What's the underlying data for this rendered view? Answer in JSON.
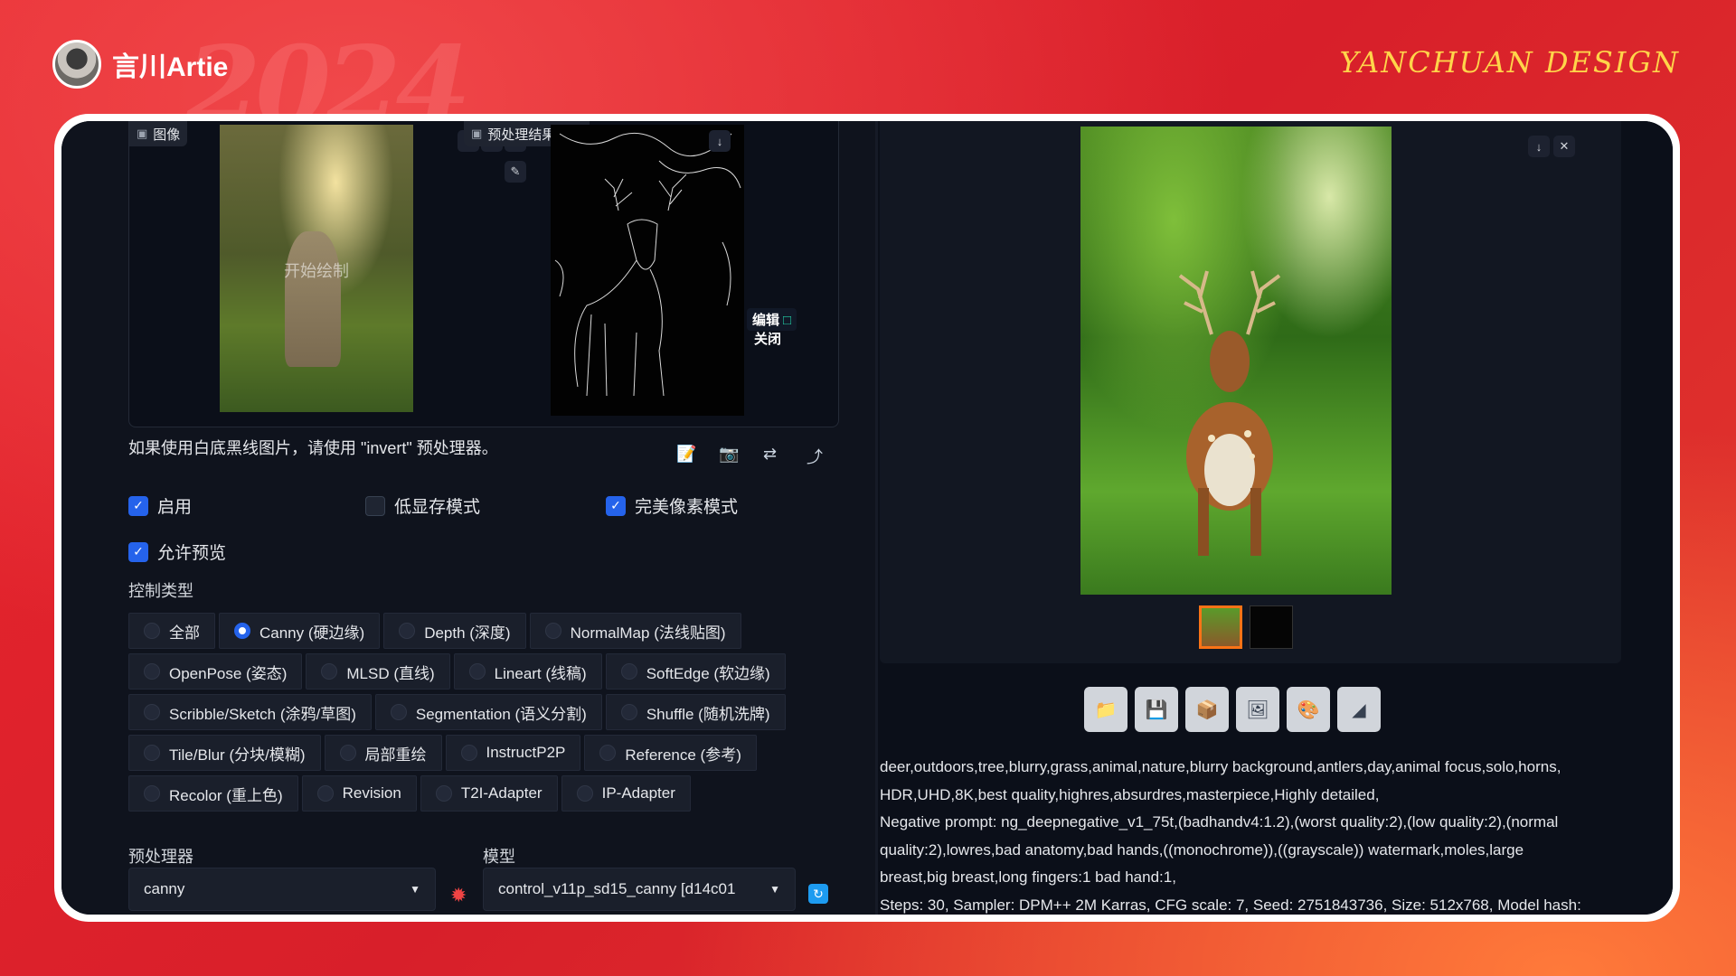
{
  "brand": {
    "name": "言川Artie",
    "logo_text": "YANCHUAN DESIGN",
    "bg_year": "2024"
  },
  "input_panel": {
    "image_label": "图像",
    "draw_hint": "开始绘制",
    "preview_label": "预处理结果预览",
    "edit_badge": "编辑",
    "close_badge": "关闭",
    "hint_text": "如果使用白底黑线图片，请使用 \"invert\" 预处理器。"
  },
  "options": {
    "enable": {
      "label": "启用",
      "checked": true
    },
    "low_vram": {
      "label": "低显存模式",
      "checked": false
    },
    "pixel_perfect": {
      "label": "完美像素模式",
      "checked": true
    },
    "allow_preview": {
      "label": "允许预览",
      "checked": true
    }
  },
  "control_type": {
    "label": "控制类型",
    "rows": [
      [
        "全部",
        "Canny (硬边缘)",
        "Depth (深度)",
        "NormalMap (法线贴图)"
      ],
      [
        "OpenPose (姿态)",
        "MLSD (直线)",
        "Lineart (线稿)",
        "SoftEdge (软边缘)"
      ],
      [
        "Scribble/Sketch (涂鸦/草图)",
        "Segmentation (语义分割)",
        "Shuffle (随机洗牌)"
      ],
      [
        "Tile/Blur (分块/模糊)",
        "局部重绘",
        "InstructP2P",
        "Reference (参考)"
      ],
      [
        "Recolor (重上色)",
        "Revision",
        "T2I-Adapter",
        "IP-Adapter"
      ]
    ],
    "selected": "Canny (硬边缘)"
  },
  "preprocessor": {
    "label": "预处理器",
    "value": "canny"
  },
  "model": {
    "label": "模型",
    "value": "control_v11p_sd15_canny [d14c01"
  },
  "output": {
    "prompt_line1": "deer,outdoors,tree,blurry,grass,animal,nature,blurry background,antlers,day,animal focus,solo,horns,",
    "prompt_line2": "HDR,UHD,8K,best quality,highres,absurdres,masterpiece,Highly detailed,",
    "negative_line1": "Negative prompt: ng_deepnegative_v1_75t,(badhandv4:1.2),(worst quality:2),(low quality:2),(normal",
    "negative_line2": "quality:2),lowres,bad anatomy,bad hands,((monochrome)),((grayscale)) watermark,moles,large",
    "negative_line3": "breast,big breast,long fingers:1 bad hand:1,",
    "params_line": "Steps: 30, Sampler: DPM++ 2M Karras, CFG scale: 7, Seed: 2751843736, Size: 512x768, Model hash:"
  }
}
